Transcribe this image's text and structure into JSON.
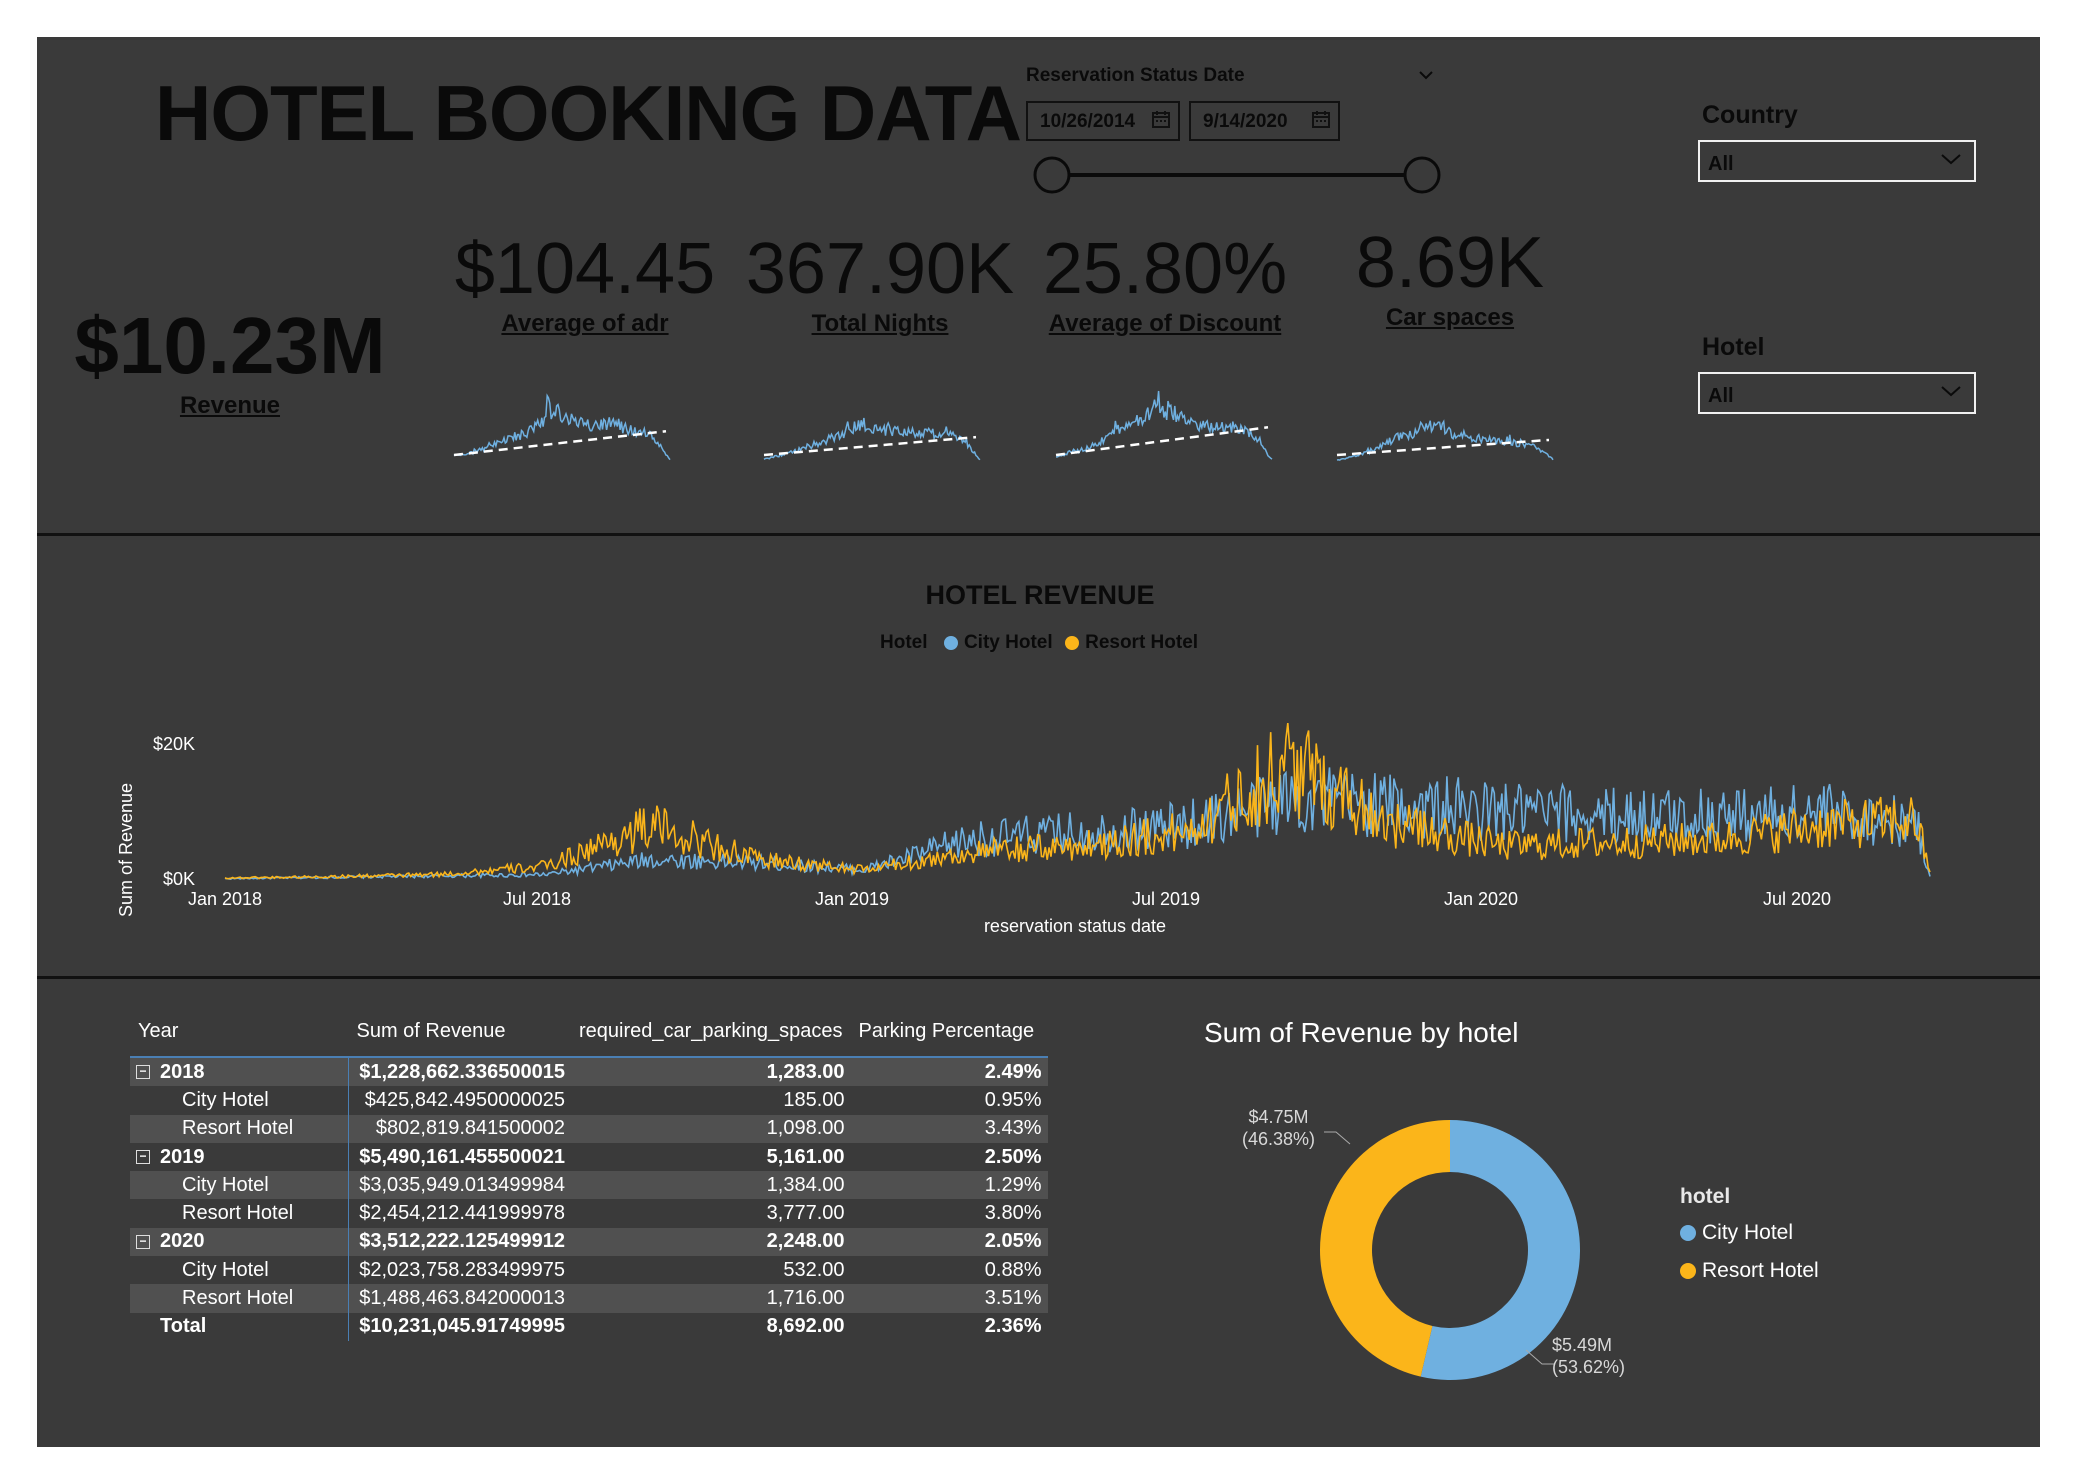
{
  "title": "HOTEL BOOKING DATA",
  "date_filter": {
    "label": "Reservation Status Date",
    "start": "10/26/2014",
    "end": "9/14/2020"
  },
  "country_filter": {
    "label": "Country",
    "value": "All"
  },
  "hotel_filter": {
    "label": "Hotel",
    "value": "All"
  },
  "kpis": {
    "revenue": {
      "value": "$10.23M",
      "label": "Revenue"
    },
    "adr": {
      "value": "$104.45",
      "label": "Average of adr"
    },
    "nights": {
      "value": "367.90K",
      "label": "Total Nights"
    },
    "discount": {
      "value": "25.80%",
      "label": "Average of Discount"
    },
    "car": {
      "value": "8.69K",
      "label": "Car spaces"
    }
  },
  "colors": {
    "city": "#6fb0e0",
    "resort": "#fbb51a",
    "panel": "#3a3a3a"
  },
  "revenue_chart": {
    "title": "HOTEL REVENUE",
    "legend_title": "Hotel",
    "series_names": [
      "City Hotel",
      "Resort Hotel"
    ],
    "ylabel": "Sum of Revenue",
    "xlabel": "reservation status date",
    "y_ticks": [
      "$20K",
      "$0K"
    ],
    "x_ticks": [
      "Jan 2018",
      "Jul 2018",
      "Jan 2019",
      "Jul 2019",
      "Jan 2020",
      "Jul 2020"
    ]
  },
  "chart_data": {
    "type": "line",
    "title": "HOTEL REVENUE",
    "xlabel": "reservation status date",
    "ylabel": "Sum of Revenue",
    "ylim": [
      0,
      25000
    ],
    "legend": "top-center",
    "x": [
      "2018-01",
      "2018-03",
      "2018-05",
      "2018-07",
      "2018-09",
      "2018-11",
      "2019-01",
      "2019-03",
      "2019-05",
      "2019-07",
      "2019-09",
      "2019-11",
      "2020-01",
      "2020-03",
      "2020-05",
      "2020-07",
      "2020-09"
    ],
    "series": [
      {
        "name": "City Hotel",
        "values": [
          200,
          400,
          600,
          800,
          3000,
          2500,
          1500,
          6000,
          7000,
          8000,
          12000,
          11000,
          10000,
          9500,
          9500,
          10000,
          8000
        ]
      },
      {
        "name": "Resort Hotel",
        "values": [
          300,
          500,
          800,
          2000,
          8000,
          3000,
          1500,
          4000,
          5000,
          7000,
          17000,
          8000,
          5000,
          5500,
          6000,
          8000,
          9000
        ]
      }
    ]
  },
  "table": {
    "headers": [
      "Year",
      "Sum of Revenue",
      "required_car_parking_spaces",
      "Parking Percentage"
    ],
    "rows": [
      {
        "level": "year",
        "name": "2018",
        "revenue": "$1,228,662.336500015",
        "parking": "1,283.00",
        "pct": "2.49%"
      },
      {
        "level": "hotel",
        "name": "City Hotel",
        "revenue": "$425,842.4950000025",
        "parking": "185.00",
        "pct": "0.95%"
      },
      {
        "level": "hotel",
        "name": "Resort Hotel",
        "revenue": "$802,819.841500002",
        "parking": "1,098.00",
        "pct": "3.43%"
      },
      {
        "level": "year",
        "name": "2019",
        "revenue": "$5,490,161.455500021",
        "parking": "5,161.00",
        "pct": "2.50%"
      },
      {
        "level": "hotel",
        "name": "City Hotel",
        "revenue": "$3,035,949.013499984",
        "parking": "1,384.00",
        "pct": "1.29%"
      },
      {
        "level": "hotel",
        "name": "Resort Hotel",
        "revenue": "$2,454,212.441999978",
        "parking": "3,777.00",
        "pct": "3.80%"
      },
      {
        "level": "year",
        "name": "2020",
        "revenue": "$3,512,222.125499912",
        "parking": "2,248.00",
        "pct": "2.05%"
      },
      {
        "level": "hotel",
        "name": "City Hotel",
        "revenue": "$2,023,758.283499975",
        "parking": "532.00",
        "pct": "0.88%"
      },
      {
        "level": "hotel",
        "name": "Resort Hotel",
        "revenue": "$1,488,463.842000013",
        "parking": "1,716.00",
        "pct": "3.51%"
      },
      {
        "level": "total",
        "name": "Total",
        "revenue": "$10,231,045.91749995",
        "parking": "8,692.00",
        "pct": "2.36%"
      }
    ]
  },
  "donut": {
    "title": "Sum of Revenue by hotel",
    "legend_title": "hotel",
    "slices": [
      {
        "name": "City Hotel",
        "value_label": "$5.49M",
        "pct_label": "(53.62%)",
        "fraction": 0.5362
      },
      {
        "name": "Resort Hotel",
        "value_label": "$4.75M",
        "pct_label": "(46.38%)",
        "fraction": 0.4638
      }
    ]
  }
}
